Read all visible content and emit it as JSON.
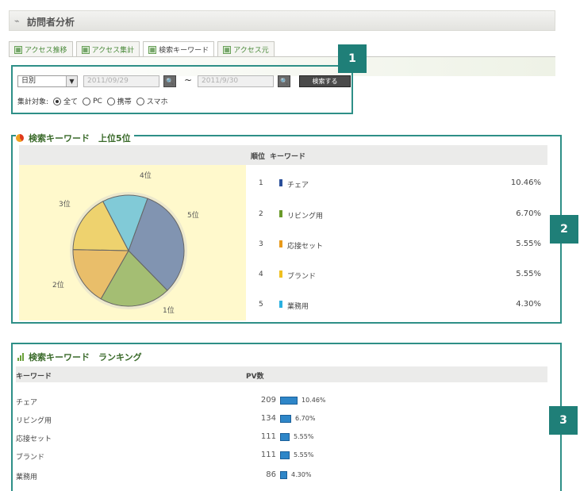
{
  "header": {
    "title": "訪問者分析"
  },
  "tabs": [
    {
      "label": "アクセス推移"
    },
    {
      "label": "アクセス集計"
    },
    {
      "label": "検索キーワード"
    },
    {
      "label": "アクセス元"
    }
  ],
  "filter": {
    "period_select": "日別",
    "date_from": "2011/09/29",
    "date_to": "2011/9/30",
    "search_button": "検索する",
    "target_label": "集計対象:",
    "options": [
      "全て",
      "PC",
      "携帯",
      "スマホ"
    ],
    "selected_option": "全て"
  },
  "badges": {
    "b1": "1",
    "b2": "2",
    "b3": "3"
  },
  "top5": {
    "title": "検索キーワード　上位5位",
    "col_rank": "順位",
    "col_keyword": "キーワード",
    "pie_labels": [
      "1位",
      "2位",
      "3位",
      "4位",
      "5位"
    ],
    "rows": [
      {
        "rank": "1",
        "keyword": "チェア",
        "percent": "10.46%",
        "color": "#2a4f9a"
      },
      {
        "rank": "2",
        "keyword": "リビング用",
        "percent": "6.70%",
        "color": "#6a9a2a"
      },
      {
        "rank": "3",
        "keyword": "応接セット",
        "percent": "5.55%",
        "color": "#e89a1a"
      },
      {
        "rank": "4",
        "keyword": "ブランド",
        "percent": "5.55%",
        "color": "#f0c020"
      },
      {
        "rank": "5",
        "keyword": "業務用",
        "percent": "4.30%",
        "color": "#2ab0e0"
      }
    ]
  },
  "ranking": {
    "title": "検索キーワード　ランキング",
    "col_keyword": "キーワード",
    "col_pv": "PV数",
    "rows": [
      {
        "keyword": "チェア",
        "pv": "209",
        "percent": "10.46%",
        "share": 10.46
      },
      {
        "keyword": "リビング用",
        "pv": "134",
        "percent": "6.70%",
        "share": 6.7
      },
      {
        "keyword": "応接セット",
        "pv": "111",
        "percent": "5.55%",
        "share": 5.55
      },
      {
        "keyword": "ブランド",
        "pv": "111",
        "percent": "5.55%",
        "share": 5.55
      },
      {
        "keyword": "業務用",
        "pv": "86",
        "percent": "4.30%",
        "share": 4.3
      }
    ]
  }
}
